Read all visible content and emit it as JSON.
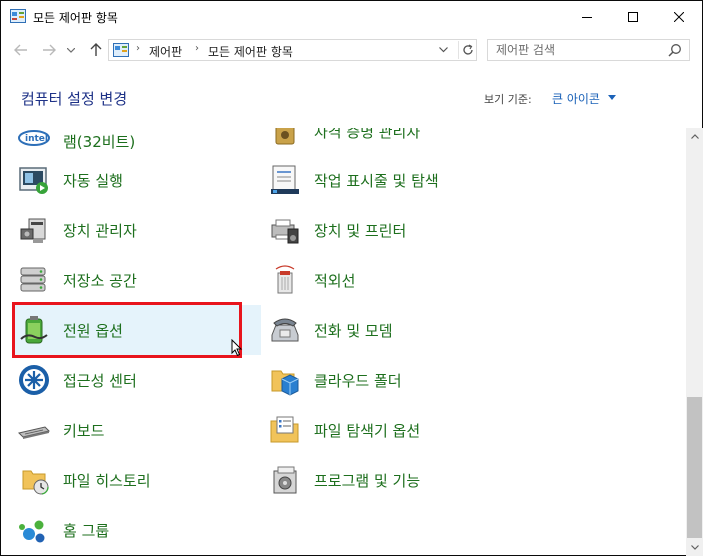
{
  "window": {
    "title": "모든 제어판 항목"
  },
  "address": {
    "crumbs": [
      "제어판",
      "모든 제어판 항목"
    ]
  },
  "search": {
    "placeholder": "제어판 검색"
  },
  "header": {
    "heading": "컴퓨터 설정 변경",
    "view_by_label": "보기 기준:",
    "view_by_value": "큰 아이콘"
  },
  "items_left": [
    {
      "label": "램(32비트)",
      "icon": "intel-graphics-icon"
    },
    {
      "label": "자동 실행",
      "icon": "autoplay-icon"
    },
    {
      "label": "장치 관리자",
      "icon": "device-manager-icon"
    },
    {
      "label": "저장소 공간",
      "icon": "storage-spaces-icon"
    },
    {
      "label": "전원 옵션",
      "icon": "power-options-icon"
    },
    {
      "label": "접근성 센터",
      "icon": "ease-of-access-icon"
    },
    {
      "label": "키보드",
      "icon": "keyboard-icon"
    },
    {
      "label": "파일 히스토리",
      "icon": "file-history-icon"
    },
    {
      "label": "홈 그룹",
      "icon": "homegroup-icon"
    }
  ],
  "items_right": [
    {
      "label": "자격 증명 관리자",
      "icon": "credential-manager-icon"
    },
    {
      "label": "작업 표시줄 및 탐색",
      "icon": "taskbar-icon"
    },
    {
      "label": "장치 및 프린터",
      "icon": "devices-printers-icon"
    },
    {
      "label": "적외선",
      "icon": "infrared-icon"
    },
    {
      "label": "전화 및 모뎀",
      "icon": "phone-modem-icon"
    },
    {
      "label": "클라우드 폴더",
      "icon": "work-folders-icon"
    },
    {
      "label": "파일 탐색기 옵션",
      "icon": "file-explorer-options-icon"
    },
    {
      "label": "프로그램 및 기능",
      "icon": "programs-features-icon"
    }
  ],
  "colors": {
    "item_text": "#1d6f1d",
    "heading": "#1e3287",
    "link": "#1b62b8",
    "highlight_box": "#e8141c",
    "hover_bg": "#e5f3fb"
  }
}
